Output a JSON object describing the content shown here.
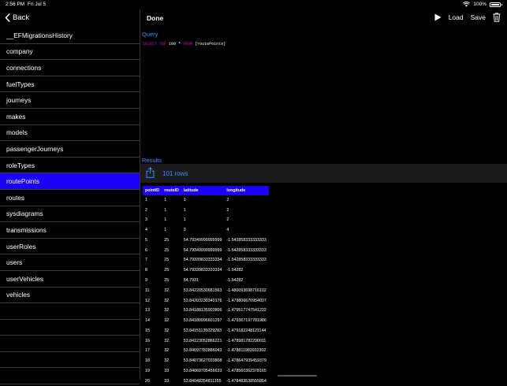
{
  "status_bar": {
    "time": "2:56 PM",
    "date": "Fri Jul 5",
    "battery": "100%"
  },
  "sidebar": {
    "back_label": "Back",
    "selected": "routePoints",
    "tables": [
      "__EFMigrationsHistory",
      "company",
      "connections",
      "fuelTypes",
      "journeys",
      "makes",
      "models",
      "passengerJourneys",
      "roleTypes",
      "routePoints",
      "routes",
      "sysdiagrams",
      "transmissions",
      "userRoles",
      "users",
      "userVehicles",
      "vehicles"
    ]
  },
  "toolbar": {
    "done_label": "Done",
    "load_label": "Load",
    "save_label": "Save"
  },
  "query": {
    "label": "Query",
    "kw_select": "SELECT TOP",
    "top_count": "100",
    "star": "*",
    "kw_from": "FROM",
    "table_ref": "[routePoints]"
  },
  "results": {
    "label": "Results",
    "rows_label": "101 rows",
    "columns": [
      "pointID",
      "routeID",
      "latitude",
      "longitude"
    ],
    "rows": [
      [
        "1",
        "1",
        "1",
        "2"
      ],
      [
        "2",
        "1",
        "1",
        "2"
      ],
      [
        "3",
        "1",
        "1",
        "2"
      ],
      [
        "4",
        "1",
        "3",
        "4"
      ],
      [
        "5",
        "25",
        "54.79349999999999",
        "-1.542858333333333"
      ],
      [
        "6",
        "25",
        "54.79349999999999",
        "-1.542858333333333"
      ],
      [
        "7",
        "25",
        "54.79339833333334",
        "-1.542858333333333"
      ],
      [
        "8",
        "25",
        "54.79339833333334",
        "-1.54282"
      ],
      [
        "9",
        "25",
        "54.7931",
        "-1.54282"
      ],
      [
        "11",
        "32",
        "53.84220530681563",
        "-1.480093698716102"
      ],
      [
        "12",
        "32",
        "53.84203230340176",
        "-1.479806670954037"
      ],
      [
        "13",
        "32",
        "53.84188135903806",
        "-1.479517747541222"
      ],
      [
        "14",
        "32",
        "53.84180996601297",
        "-1.479367197781986"
      ],
      [
        "15",
        "32",
        "53.84151135029283",
        "-1.479182248121144"
      ],
      [
        "16",
        "32",
        "53.84123052866221",
        "-1.478981782290011"
      ],
      [
        "17",
        "32",
        "53.84097783886043",
        "-1.478811983932302"
      ],
      [
        "18",
        "32",
        "53.84073627033808",
        "-1.478647939459379"
      ],
      [
        "19",
        "33",
        "53.84060705456633",
        "-1.478560362378165"
      ],
      [
        "20",
        "33",
        "53.84048354811155",
        "-1.478483538555854"
      ]
    ]
  }
}
